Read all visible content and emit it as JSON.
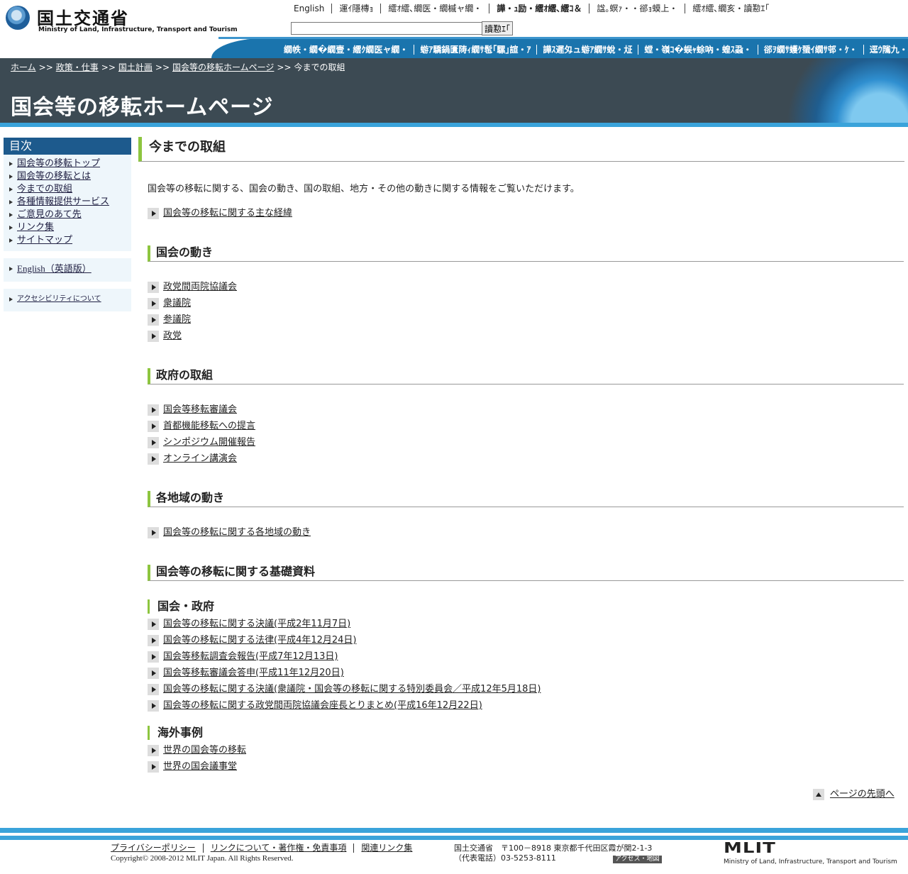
{
  "header": {
    "logo_jp": "国土交通省",
    "logo_en": "Ministry of Land, Infrastructure, Transport and Tourism",
    "util_links": [
      "English",
      "運ｲ隱槫ｮ",
      "繧ｵ繧､繝医・繝槭ャ繝・",
      "譁・ｭ励・繧ｵ繧､繧ｺ＆",
      "諡｡螟ｧ・・郤ｮ蟆上・",
      "繧ｵ繧､繝亥・讀懃ｴ｢"
    ],
    "search_value": "",
    "search_button": "讀懃ｴ｢",
    "nav": [
      "繝帙・繝�繝壹・繧ｸ繝医ャ繝・",
      "蝣ｱ驕鍋匱陦ｨ繝ｻ髢｢騾｣諠・ｱ",
      "譁ｽ遲匁ュ蝣ｱ繝ｻ蛻・㍽",
      "螳・嶺ｺ�蜈ｬ蜍吶・蝗ｽ蝨・",
      "郤ｦ繝ｻ蠖ｹ蜑ｲ繝ｻ邨・ｹ・",
      "逕ｳ隲九・謇狗ｶ・"
    ]
  },
  "breadcrumb": {
    "items": [
      "ホーム",
      "政策・仕事",
      "国土計画",
      "国会等の移転ホームページ"
    ],
    "current": "今までの取組",
    "sep": ">>"
  },
  "page_title": "国会等の移転ホームページ",
  "sidebar": {
    "toc_title": "目次",
    "items": [
      "国会等の移転トップ",
      "国会等の移転とは",
      "今までの取組",
      "各種情報提供サービス",
      "ご意見のあて先",
      "リンク集",
      "サイトマップ"
    ],
    "english": "English（英語版）",
    "accessibility": "アクセシビリティについて"
  },
  "main": {
    "heading": "今までの取組",
    "intro": "国会等の移転に関する、国会の動き、国の取組、地方・その他の動きに関する情報をご覧いただけます。",
    "top_link": "国会等の移転に関する主な経緯",
    "sections": [
      {
        "title": "国会の動き",
        "links": [
          "政党間両院協議会",
          "衆議院",
          "参議院",
          "政党"
        ]
      },
      {
        "title": "政府の取組",
        "links": [
          "国会等移転審議会",
          "首都機能移転への提言",
          "シンポジウム開催報告",
          "オンライン講演会"
        ]
      },
      {
        "title": "各地域の動き",
        "links": [
          "国会等の移転に関する各地域の動き"
        ]
      },
      {
        "title": "国会等の移転に関する基礎資料"
      }
    ],
    "sub_sections": [
      {
        "title": "国会・政府",
        "links": [
          "国会等の移転に関する決議(平成2年11月7日)",
          "国会等の移転に関する法律(平成4年12月24日)",
          "国会等移転調査会報告(平成7年12月13日)",
          "国会等移転審議会答申(平成11年12月20日)",
          "国会等の移転に関する決議(衆議院・国会等の移転に関する特別委員会／平成12年5月18日)",
          "国会等の移転に関する政党間両院協議会座長とりまとめ(平成16年12月22日)"
        ]
      },
      {
        "title": "海外事例",
        "links": [
          "世界の国会等の移転",
          "世界の国会議事堂"
        ]
      }
    ],
    "to_top": "ページの先頭へ"
  },
  "footer": {
    "links": [
      "プライバシーポリシー",
      "リンクについて・著作権・免責事項",
      "関連リンク集"
    ],
    "copyright": "Copyright© 2008-2012 MLIT Japan. All Rights Reserved.",
    "org": "国土交通省",
    "address": "〒100－8918 東京都千代田区霞が関2-1-3",
    "tel": "（代表電話）03-5253-8111",
    "access": "アクセス・地図",
    "mlit_logo": "MLIT",
    "mlit_en": "Ministry of Land, Infrastructure, Transport and Tourism"
  }
}
